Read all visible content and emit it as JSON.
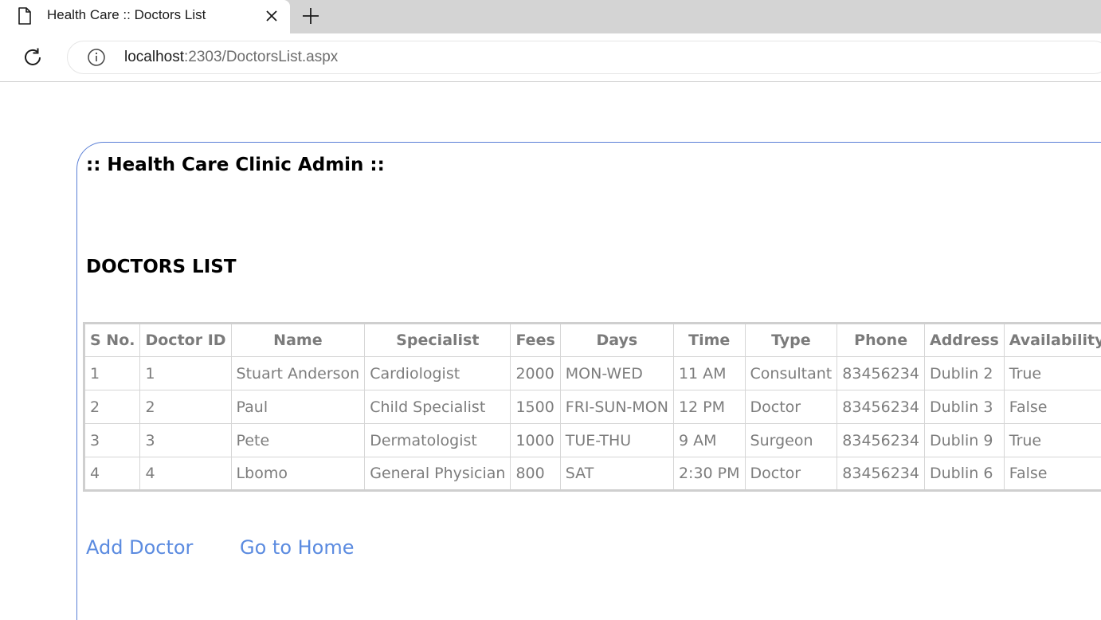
{
  "browser": {
    "tab_title": "Health Care :: Doctors List",
    "url_host": "localhost",
    "url_rest": ":2303/DoctorsList.aspx"
  },
  "page": {
    "site_title": ":: Health Care Clinic Admin ::",
    "section_title": "DOCTORS LIST",
    "links": {
      "add_doctor": "Add Doctor",
      "go_home": "Go to Home"
    }
  },
  "table": {
    "columns": [
      "S No.",
      "Doctor ID",
      "Name",
      "Specialist",
      "Fees",
      "Days",
      "Time",
      "Type",
      "Phone",
      "Address",
      "Availability"
    ],
    "rows": [
      [
        "1",
        "1",
        "Stuart Anderson",
        "Cardiologist",
        "2000",
        "MON-WED",
        "11 AM",
        "Consultant",
        "83456234",
        "Dublin 2",
        "True"
      ],
      [
        "2",
        "2",
        "Paul",
        "Child Specialist",
        "1500",
        "FRI-SUN-MON",
        "12 PM",
        "Doctor",
        "83456234",
        "Dublin 3",
        "False"
      ],
      [
        "3",
        "3",
        "Pete",
        "Dermatologist",
        "1000",
        "TUE-THU",
        "9 AM",
        "Surgeon",
        "83456234",
        "Dublin 9",
        "True"
      ],
      [
        "4",
        "4",
        "Lbomo",
        "General Physician",
        "800",
        "SAT",
        "2:30 PM",
        "Doctor",
        "83456234",
        "Dublin 6",
        "False"
      ]
    ]
  },
  "colors": {
    "link": "#5b8be0",
    "frame_border": "#5a7fd6",
    "table_text": "#7d7d7d"
  }
}
